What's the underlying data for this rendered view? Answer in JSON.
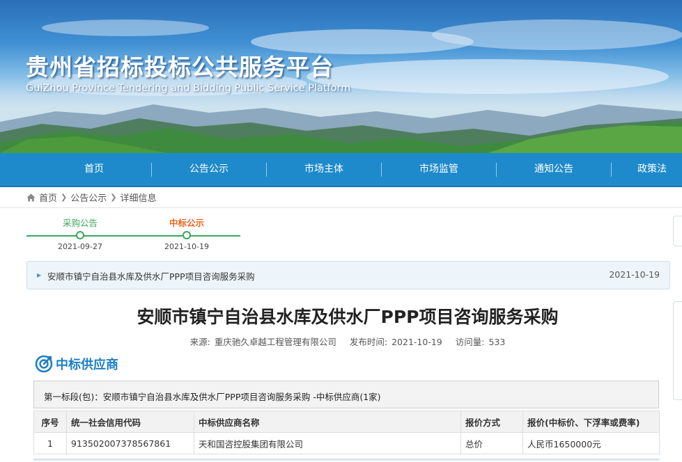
{
  "header": {
    "title": "贵州省招标投标公共服务平台",
    "subtitle": "GuiZhou Province Tendering and Bidding Public Service Platform"
  },
  "nav": {
    "items": [
      {
        "label": "首页"
      },
      {
        "label": "公告公示"
      },
      {
        "label": "市场主体"
      },
      {
        "label": "市场监管"
      },
      {
        "label": "通知公告"
      },
      {
        "label": "政策法"
      }
    ]
  },
  "breadcrumb": {
    "home": "首页",
    "level1": "公告公示",
    "level2": "详细信息"
  },
  "timeline": {
    "steps": [
      {
        "label": "采购公告",
        "date": "2021-09-27",
        "color": "#3aa65a"
      },
      {
        "label": "中标公示",
        "date": "2021-10-19",
        "color": "#e8641b"
      }
    ]
  },
  "notice": {
    "title": "安顺市镇宁自治县水库及供水厂PPP项目咨询服务采购",
    "date": "2021-10-19"
  },
  "article": {
    "title": "安顺市镇宁自治县水库及供水厂PPP项目咨询服务采购",
    "source_label": "来源:",
    "source": "重庆驰久卓越工程管理有限公司",
    "publish_label": "发布时间:",
    "publish_date": "2021-10-19",
    "views_label": "访问量:",
    "views": "533"
  },
  "winner_section": {
    "title": "中标供应商",
    "package_text": "第一标段(包)：安顺市镇宁自治县水库及供水厂PPP项目咨询服务采购 -中标供应商(1家)",
    "columns": [
      "序号",
      "统一社会信用代码",
      "中标供应商名称",
      "报价方式",
      "报价(中标价、下浮率或费率)"
    ],
    "rows": [
      {
        "no": "1",
        "code": "913502007378567861",
        "name": "天和国咨控股集团有限公司",
        "method": "总价",
        "price": "人民币1650000元"
      }
    ]
  },
  "colors": {
    "nav_bg": "#1f8acb",
    "accent_blue": "#1d7fc4",
    "step_done": "#3aa65a",
    "step_current": "#e8641b"
  }
}
